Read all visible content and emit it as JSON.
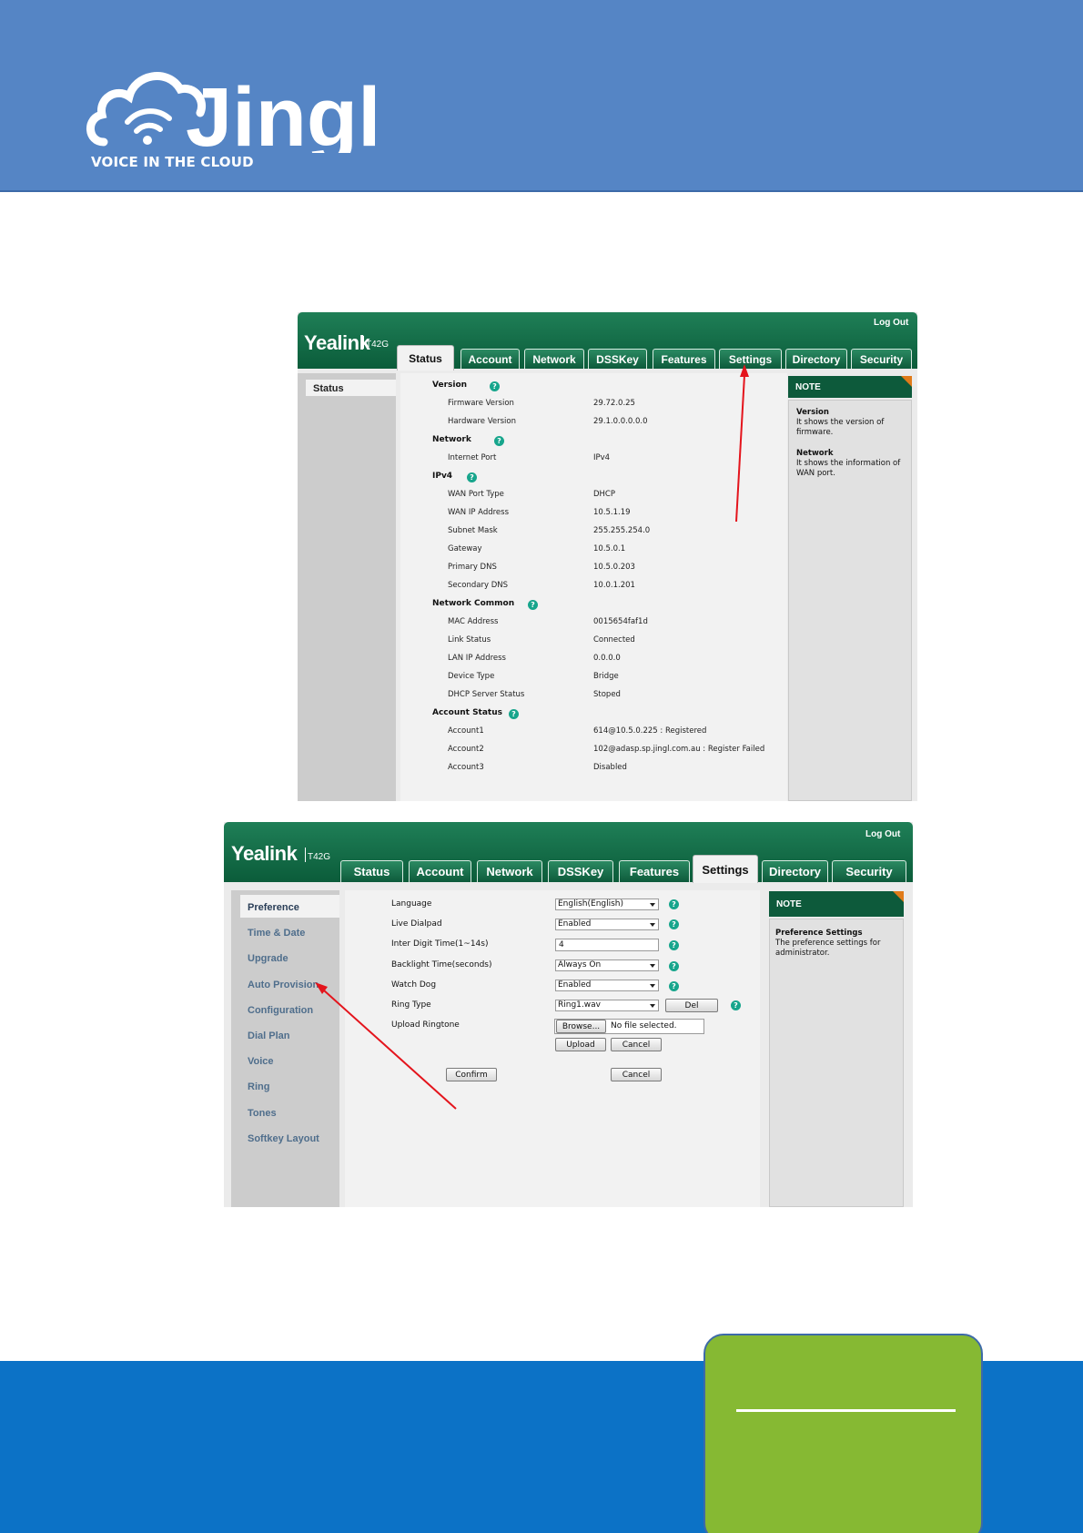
{
  "brand": {
    "logo_text": "Jingl",
    "tagline": "VOICE IN THE CLOUD"
  },
  "colors": {
    "header_blue": "#5585c5",
    "footer_blue": "#0c72c6",
    "footer_card_green": "#86b933",
    "yealink_green": "#0d5a3b",
    "annotation_red": "#e4141c"
  },
  "status_screen": {
    "brand": "Yealink",
    "model": "T42G",
    "logout": "Log Out",
    "tabs": [
      "Status",
      "Account",
      "Network",
      "DSSKey",
      "Features",
      "Settings",
      "Directory",
      "Security"
    ],
    "active_tab": "Status",
    "sidebar": [
      "Status"
    ],
    "sections": [
      {
        "title": "Version",
        "rows": [
          {
            "label": "Firmware Version",
            "value": "29.72.0.25"
          },
          {
            "label": "Hardware Version",
            "value": "29.1.0.0.0.0.0"
          }
        ]
      },
      {
        "title": "Network",
        "rows": [
          {
            "label": "Internet Port",
            "value": "IPv4"
          }
        ]
      },
      {
        "title": "IPv4",
        "rows": [
          {
            "label": "WAN Port Type",
            "value": "DHCP"
          },
          {
            "label": "WAN IP Address",
            "value": "10.5.1.19"
          },
          {
            "label": "Subnet Mask",
            "value": "255.255.254.0"
          },
          {
            "label": "Gateway",
            "value": "10.5.0.1"
          },
          {
            "label": "Primary DNS",
            "value": "10.5.0.203"
          },
          {
            "label": "Secondary DNS",
            "value": "10.0.1.201"
          }
        ]
      },
      {
        "title": "Network Common",
        "rows": [
          {
            "label": "MAC Address",
            "value": "0015654faf1d"
          },
          {
            "label": "Link Status",
            "value": "Connected"
          },
          {
            "label": "LAN IP Address",
            "value": "0.0.0.0"
          },
          {
            "label": "Device Type",
            "value": "Bridge"
          },
          {
            "label": "DHCP Server Status",
            "value": "Stoped"
          }
        ]
      },
      {
        "title": "Account Status",
        "rows": [
          {
            "label": "Account1",
            "value": "614@10.5.0.225 : Registered"
          },
          {
            "label": "Account2",
            "value": "102@adasp.sp.jingl.com.au : Register Failed"
          },
          {
            "label": "Account3",
            "value": "Disabled"
          }
        ]
      }
    ],
    "note": {
      "title": "NOTE",
      "items": [
        {
          "heading": "Version",
          "text": "It shows the version of firmware."
        },
        {
          "heading": "Network",
          "text": "It shows the information of WAN port."
        }
      ]
    }
  },
  "settings_screen": {
    "brand": "Yealink",
    "model": "T42G",
    "logout": "Log Out",
    "tabs": [
      "Status",
      "Account",
      "Network",
      "DSSKey",
      "Features",
      "Settings",
      "Directory",
      "Security"
    ],
    "active_tab": "Settings",
    "sidebar": [
      "Preference",
      "Time & Date",
      "Upgrade",
      "Auto Provision",
      "Configuration",
      "Dial Plan",
      "Voice",
      "Ring",
      "Tones",
      "Softkey Layout"
    ],
    "active_sidebar": "Preference",
    "form": {
      "language": {
        "label": "Language",
        "value": "English(English)"
      },
      "live_dialpad": {
        "label": "Live Dialpad",
        "value": "Enabled"
      },
      "inter_digit": {
        "label": "Inter Digit Time(1~14s)",
        "value": "4"
      },
      "backlight": {
        "label": "Backlight Time(seconds)",
        "value": "Always On"
      },
      "watch_dog": {
        "label": "Watch Dog",
        "value": "Enabled"
      },
      "ring_type": {
        "label": "Ring Type",
        "value": "Ring1.wav",
        "del": "Del"
      },
      "upload_ringtone": {
        "label": "Upload Ringtone",
        "browse": "Browse...",
        "file_status": "No file selected.",
        "upload": "Upload",
        "cancel": "Cancel"
      },
      "confirm": "Confirm",
      "cancel": "Cancel"
    },
    "note": {
      "title": "NOTE",
      "items": [
        {
          "heading": "Preference Settings",
          "text": "The preference settings for administrator."
        }
      ]
    }
  }
}
